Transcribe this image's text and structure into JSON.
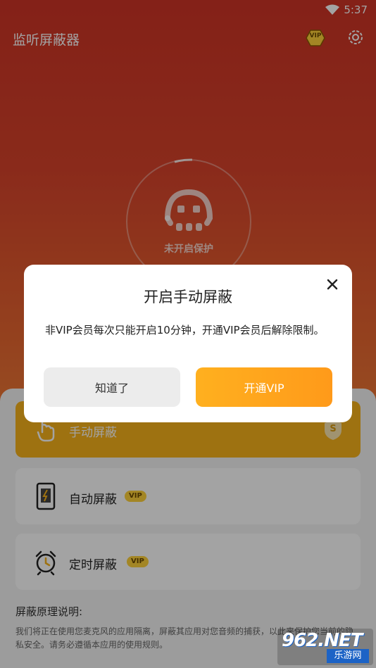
{
  "status_bar": {
    "time": "5:37"
  },
  "app": {
    "title": "监听屏蔽器",
    "vip_badge": "VIP"
  },
  "shield": {
    "status": "未开启保护"
  },
  "modes": [
    {
      "label": "手动屏蔽",
      "badge": "S",
      "active": true
    },
    {
      "label": "自动屏蔽",
      "tag": "VIP"
    },
    {
      "label": "定时屏蔽",
      "tag": "VIP"
    }
  ],
  "explanation": {
    "title": "屏蔽原理说明:",
    "text": "我们将正在使用您麦克风的应用隔离，屏蔽其应用对您音频的捕获，以此来保护您当前的隐私安全。请务必遵循本应用的使用规则。"
  },
  "dialog": {
    "title": "开启手动屏蔽",
    "message": "非VIP会员每次只能开启10分钟，开通VIP会员后解除限制。",
    "ok_label": "知道了",
    "vip_label": "开通VIP"
  },
  "watermark": {
    "top": "962.NET",
    "bottom": "乐游网"
  },
  "colors": {
    "accent": "#f7b21b",
    "hero_top": "#cf3426",
    "vip_button": "#ffa41d"
  }
}
